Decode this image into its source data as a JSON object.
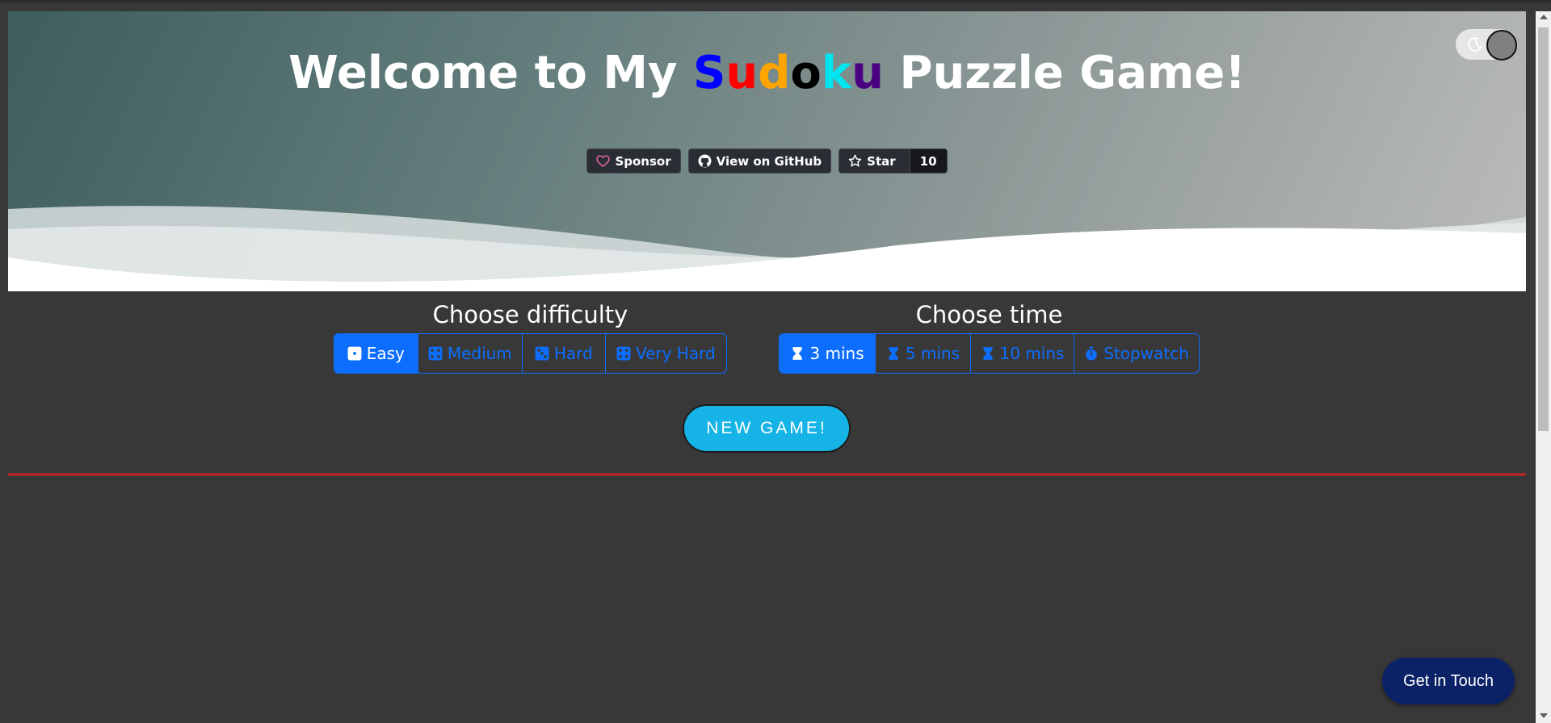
{
  "header": {
    "title_prefix": "Welcome to My ",
    "title_word_letters": [
      "S",
      "u",
      "d",
      "o",
      "k",
      "u"
    ],
    "title_suffix": " Puzzle Game!",
    "letter_colors": [
      "#0000ff",
      "#ff0000",
      "#ffa500",
      "#000000",
      "#00e5ee",
      "#4b0082"
    ]
  },
  "github": {
    "sponsor_label": "Sponsor",
    "view_label": "View on GitHub",
    "star_label": "Star",
    "star_count": "10"
  },
  "theme_toggle": {
    "mode_icon": "moon-icon"
  },
  "difficulty": {
    "heading": "Choose difficulty",
    "options": [
      {
        "label": "Easy",
        "icon": "dice-1-icon",
        "selected": true
      },
      {
        "label": "Medium",
        "icon": "dice-2-icon",
        "selected": false
      },
      {
        "label": "Hard",
        "icon": "dice-3-icon",
        "selected": false
      },
      {
        "label": "Very Hard",
        "icon": "dice-4-icon",
        "selected": false
      }
    ]
  },
  "time": {
    "heading": "Choose time",
    "options": [
      {
        "label": "3 mins",
        "icon": "hourglass-icon",
        "selected": true
      },
      {
        "label": "5 mins",
        "icon": "hourglass-icon",
        "selected": false
      },
      {
        "label": "10 mins",
        "icon": "hourglass-icon",
        "selected": false
      },
      {
        "label": "Stopwatch",
        "icon": "stopwatch-icon",
        "selected": false
      }
    ]
  },
  "new_game_label": "NEW GAME!",
  "contact_label": "Get in Touch",
  "colors": {
    "accent": "#0d6efd",
    "new_game": "#15b3e6",
    "divider": "#a52a2a",
    "contact": "#0b2266",
    "background": "#383838"
  }
}
